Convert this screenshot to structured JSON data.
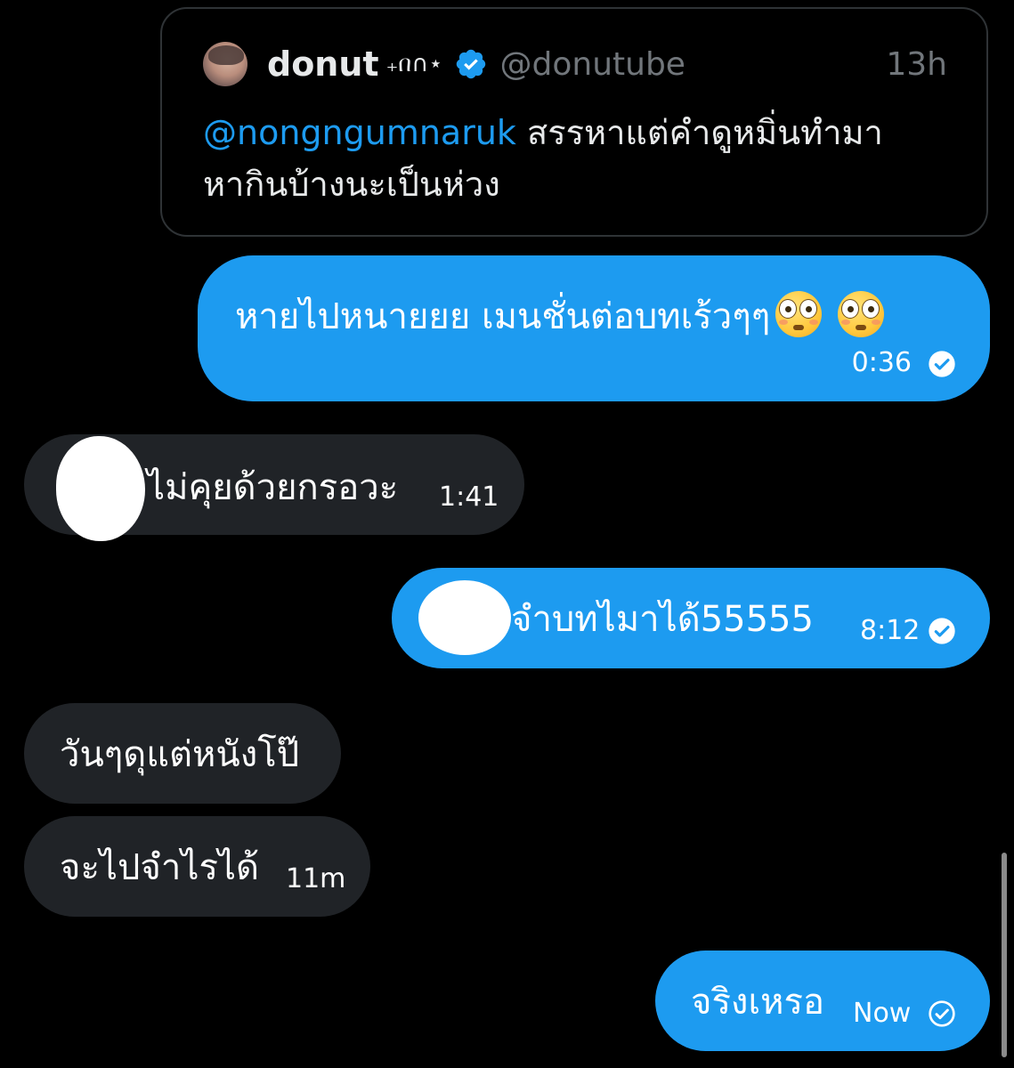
{
  "quoted_tweet": {
    "display_name": "donut",
    "name_decoration": "₊በ∩⋆",
    "handle": "@donutube",
    "time_ago": "13h",
    "mention": "@nongngumnaruk",
    "text_line1": " สรรหาแต่คำดูหมิ่นทำมา",
    "text_line2": "หากินบ้างนะเป็นห่วง",
    "verified": true
  },
  "messages": [
    {
      "id": "m1",
      "direction": "outgoing",
      "text": "หายไปหนายยย เมนชั่นต่อบทเร้วๆๆ",
      "emoji": [
        "flushed-face-emoji",
        "flushed-face-emoji"
      ],
      "time": "0:36",
      "status": "read"
    },
    {
      "id": "m2",
      "direction": "incoming",
      "text": "ไม่คุยด้วยกรอวะ",
      "time": "1:41",
      "redacted_prefix": true
    },
    {
      "id": "m3",
      "direction": "outgoing",
      "text": "จำบทไมาได้55555",
      "time": "8:12",
      "status": "read",
      "redacted_prefix": true
    },
    {
      "id": "m4",
      "direction": "incoming",
      "text": "วันๆดุแต่หนังโป๊",
      "time": ""
    },
    {
      "id": "m5",
      "direction": "incoming",
      "text": "จะไปจำไรได้",
      "time": "11m"
    },
    {
      "id": "m6",
      "direction": "outgoing",
      "text": "จริงเหรอ",
      "time": "Now",
      "status": "sent"
    }
  ],
  "colors": {
    "background": "#000000",
    "outgoing_bubble": "#1d9bf0",
    "incoming_bubble": "#202327",
    "mention": "#1d9bf0",
    "muted_text": "#71767b",
    "card_border": "#2f3336"
  }
}
